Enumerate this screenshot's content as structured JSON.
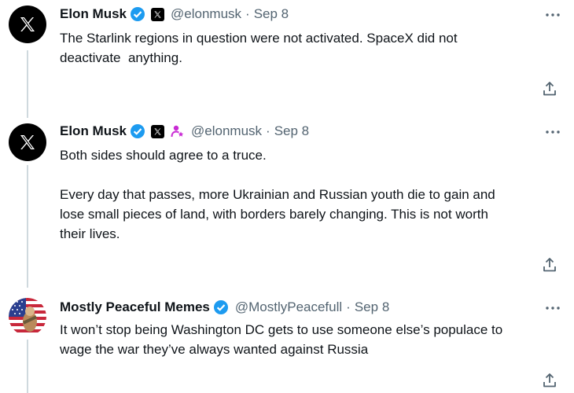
{
  "tweets": [
    {
      "author": "Elon Musk",
      "handle": "@elonmusk",
      "separator": "·",
      "date": "Sep 8",
      "text": "The Starlink regions in question were not activated. SpaceX did not\ndeactivate  anything."
    },
    {
      "author": "Elon Musk",
      "handle": "@elonmusk",
      "separator": "·",
      "date": "Sep 8",
      "text": "Both sides should agree to a truce.\n\nEvery day that passes, more Ukrainian and Russian youth die to gain and\nlose small pieces of land, with borders barely changing. This is not worth\ntheir lives."
    },
    {
      "author": "Mostly Peaceful Memes",
      "handle": "@MostlyPeacefull",
      "separator": "·",
      "date": "Sep 8",
      "text": "It won’t stop being Washington DC gets to use someone else’s populace to\nwage the war they’ve always wanted against Russia"
    }
  ],
  "icons": {
    "verified": "verified-badge-icon",
    "x_affiliate": "x-affiliate-icon",
    "person": "person-icon",
    "more": "more-icon",
    "share": "share-icon"
  },
  "colors": {
    "verified": "#1d9bf0",
    "person_icon": "#c92bd4",
    "secondary_text": "#536471",
    "thread_line": "#cfd9de"
  }
}
